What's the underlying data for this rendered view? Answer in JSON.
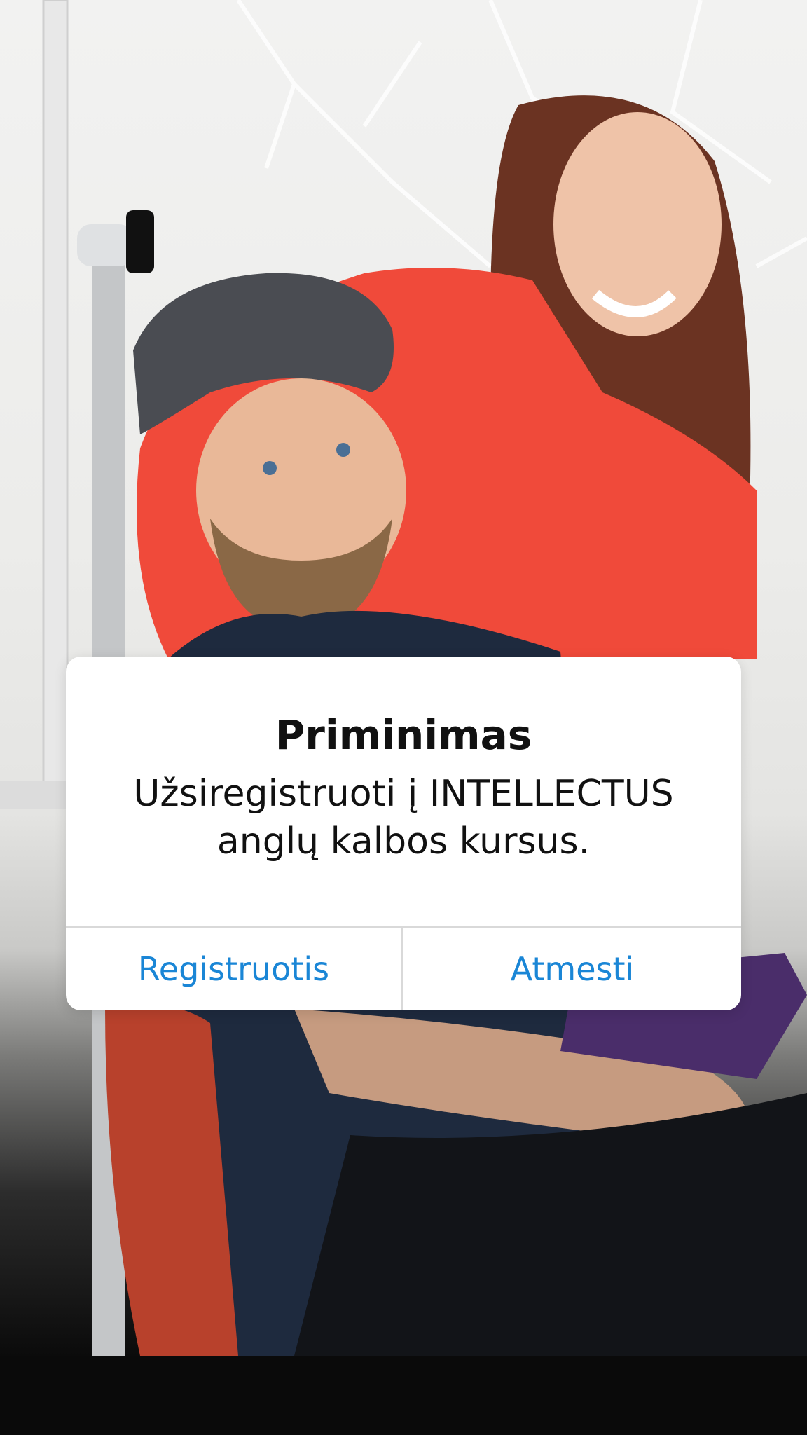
{
  "dialog": {
    "title": "Priminimas",
    "message": "Užsiregistruoti į INTELLECTUS anglų kalbos kursus.",
    "primary_button": "Registruotis",
    "secondary_button": "Atmesti"
  },
  "colors": {
    "button_text": "#1a86d6",
    "dialog_background": "#ffffff",
    "title_text": "#111111",
    "red_sweater": "#f04a3a"
  }
}
